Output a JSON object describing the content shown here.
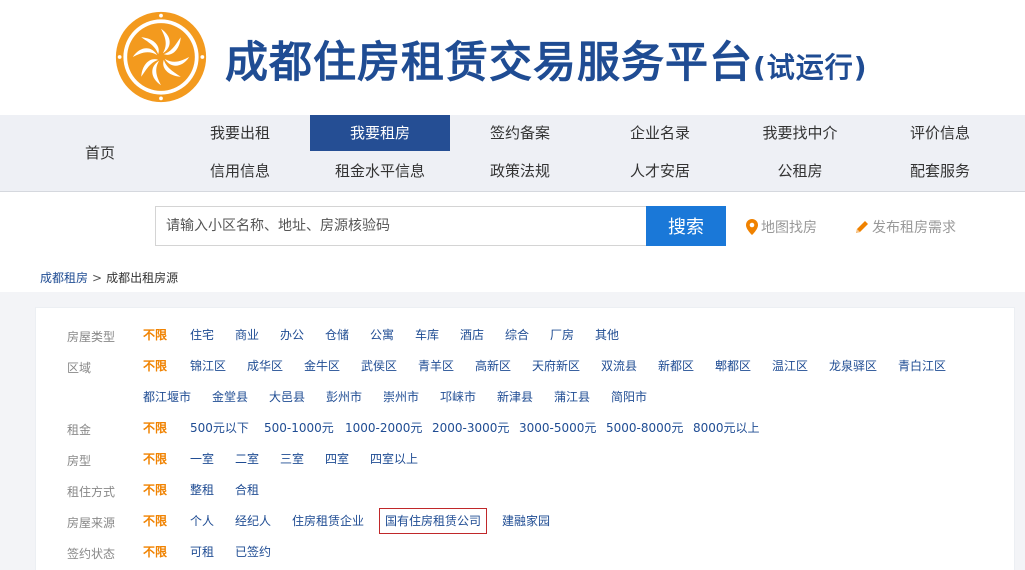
{
  "header": {
    "title": "成都住房租赁交易服务平台",
    "subtitle": "(试运行)",
    "logo_icon": "swirl-sun-logo",
    "brand_color": "#1f4c93",
    "logo_color": "#f39a1e"
  },
  "nav": {
    "home": "首页",
    "row1": [
      "我要出租",
      "我要租房",
      "签约备案",
      "企业名录",
      "我要找中介",
      "评价信息"
    ],
    "row2": [
      "信用信息",
      "租金水平信息",
      "政策法规",
      "人才安居",
      "公租房",
      "配套服务"
    ],
    "active": "我要租房",
    "active_color": "#254e94"
  },
  "search": {
    "placeholder": "请输入小区名称、地址、房源核验码",
    "button": "搜索",
    "map_link": "地图找房",
    "post_link": "发布租房需求",
    "button_color": "#1a78d8"
  },
  "breadcrumb": {
    "root": "成都租房",
    "current": "成都出租房源"
  },
  "filters": {
    "selected_color": "#f08200",
    "house_type": {
      "label": "房屋类型",
      "options": [
        "不限",
        "住宅",
        "商业",
        "办公",
        "仓储",
        "公寓",
        "车库",
        "酒店",
        "综合",
        "厂房",
        "其他"
      ]
    },
    "region": {
      "label": "区域",
      "options_row1": [
        "不限",
        "锦江区",
        "成华区",
        "金牛区",
        "武侯区",
        "青羊区",
        "高新区",
        "天府新区",
        "双流县",
        "新都区",
        "郫都区",
        "温江区",
        "龙泉驿区",
        "青白江区"
      ],
      "options_row2": [
        "都江堰市",
        "金堂县",
        "大邑县",
        "彭州市",
        "崇州市",
        "邛崃市",
        "新津县",
        "蒲江县",
        "简阳市"
      ]
    },
    "rent": {
      "label": "租金",
      "options": [
        "不限",
        "500元以下",
        "500-1000元",
        "1000-2000元",
        "2000-3000元",
        "3000-5000元",
        "5000-8000元",
        "8000元以上"
      ]
    },
    "room_type": {
      "label": "房型",
      "options": [
        "不限",
        "一室",
        "二室",
        "三室",
        "四室",
        "四室以上"
      ]
    },
    "rent_mode": {
      "label": "租住方式",
      "options": [
        "不限",
        "整租",
        "合租"
      ]
    },
    "source": {
      "label": "房屋来源",
      "options": [
        "不限",
        "个人",
        "经纪人",
        "住房租赁企业",
        "国有住房租赁公司",
        "建融家园"
      ]
    },
    "contract": {
      "label": "签约状态",
      "options": [
        "不限",
        "可租",
        "已签约"
      ]
    }
  }
}
